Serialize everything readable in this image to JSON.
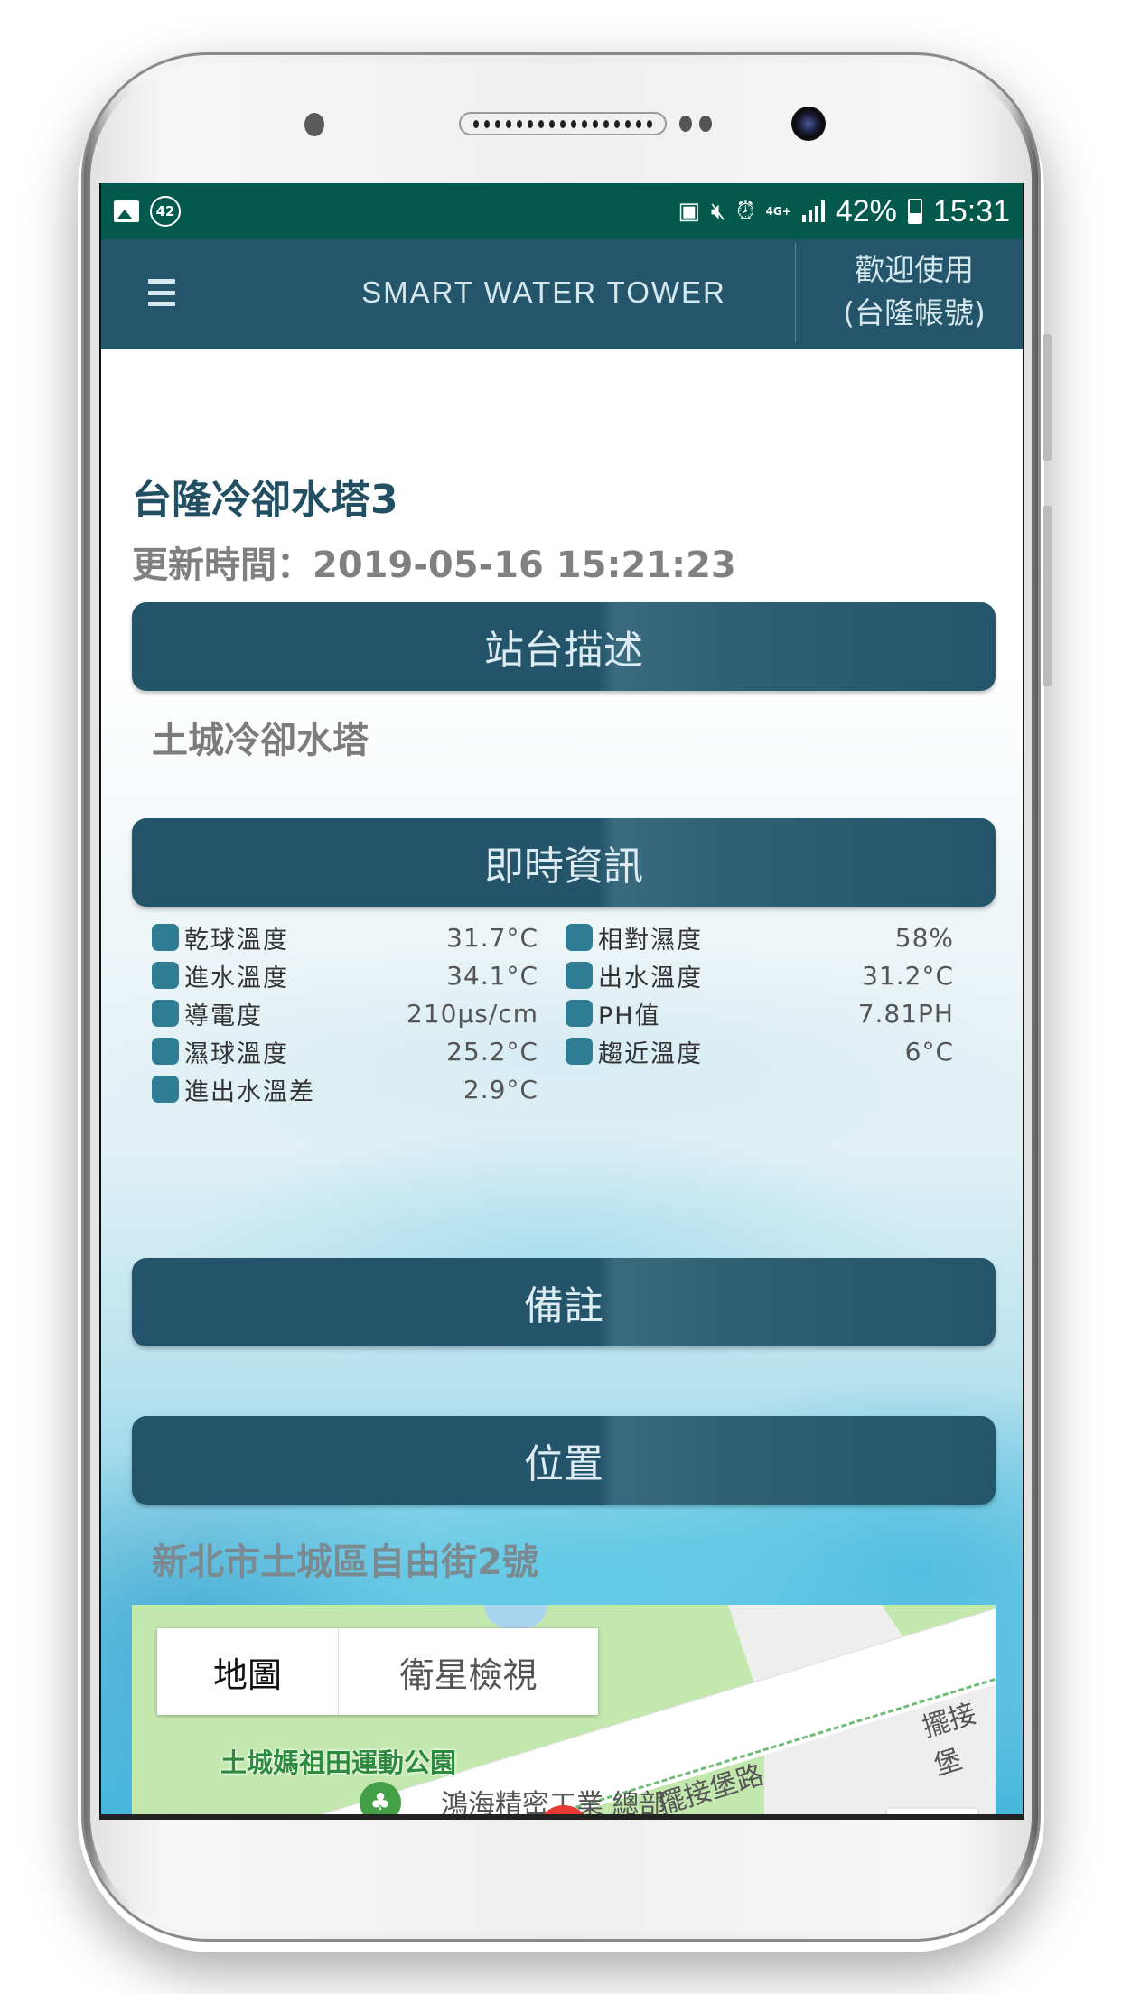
{
  "status_bar": {
    "notification_count": "42",
    "network": "4G+",
    "battery": "42%",
    "time": "15:31"
  },
  "app_bar": {
    "title": "SMART WATER TOWER",
    "welcome_line1": "歡迎使用",
    "welcome_line2": "(台隆帳號)"
  },
  "station": {
    "name": "台隆冷卻水塔3",
    "update_time": "更新時間：2019-05-16 15:21:23"
  },
  "sections": {
    "description": {
      "header": "站台描述",
      "text": "土城冷卻水塔"
    },
    "realtime": {
      "header": "即時資訊"
    },
    "notes": {
      "header": "備註"
    },
    "location": {
      "header": "位置",
      "address": "新北市土城區自由街2號"
    }
  },
  "metrics": {
    "left": [
      {
        "label": "乾球溫度",
        "value": "31.7°C"
      },
      {
        "label": "進水溫度",
        "value": "34.1°C"
      },
      {
        "label": "導電度",
        "value": "210μs/cm"
      },
      {
        "label": "濕球溫度",
        "value": "25.2°C"
      },
      {
        "label": "進出水溫差",
        "value": "2.9°C"
      }
    ],
    "right": [
      {
        "label": "相對濕度",
        "value": "58%"
      },
      {
        "label": "出水溫度",
        "value": "31.2°C"
      },
      {
        "label": "PH值",
        "value": "7.81PH"
      },
      {
        "label": "趨近溫度",
        "value": "6°C"
      }
    ],
    "indicator_color": "#2e7d95"
  },
  "map": {
    "toggle_map": "地圖",
    "toggle_satellite": "衛星檢視",
    "park_label": "土城媽祖田運動公園",
    "road_label": "擺接堡路",
    "road_label_edge": "擺接堡",
    "place_label": "鴻海精密工業 總部"
  },
  "colors": {
    "status_bar": "#035a4c",
    "app_bar": "#24556a",
    "section_header": "#23546a",
    "title_text": "#234f63"
  }
}
